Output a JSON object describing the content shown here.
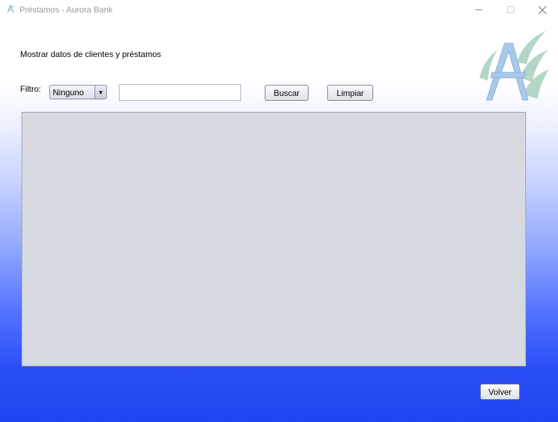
{
  "window": {
    "title": "Préstamos - Aurora Bank",
    "controls": {
      "minimize": "minimize-icon",
      "maximize": "maximize-icon",
      "close": "close-icon"
    }
  },
  "header": {
    "label": "Mostrar datos de clientes y préstamos",
    "logo_icon": "aurora-bank-logo"
  },
  "filter": {
    "label": "Filtro:",
    "selected": "Ninguno",
    "search_value": "",
    "search_placeholder": ""
  },
  "buttons": {
    "search": "Buscar",
    "clear": "Limpiar",
    "back": "Volver"
  },
  "table": {
    "columns": [],
    "rows": []
  },
  "colors": {
    "gradient_top": "#ffffff",
    "gradient_bottom": "#1f45f0",
    "table_background": "#d6d9e0",
    "logo_letter": "#a9c9ea",
    "logo_waves": "#b3d6c6"
  }
}
